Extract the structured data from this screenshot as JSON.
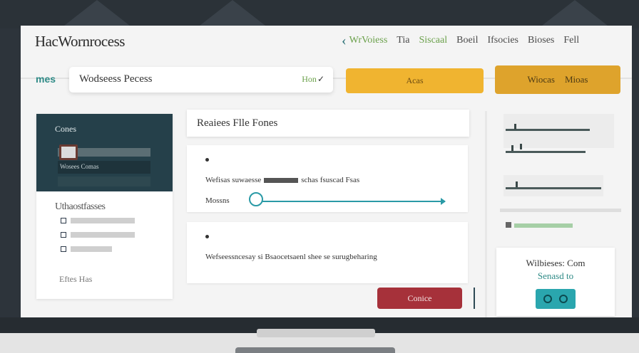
{
  "app": {
    "title": "HacWornrocess"
  },
  "nav": {
    "items": [
      "WrVoiess",
      "Tia",
      "Siscaal",
      "Boeil",
      "Ifsocies",
      "Bioses",
      "Fell"
    ]
  },
  "left_label": "mes",
  "search": {
    "value": "Wodseess Pecess",
    "filter": "Hon"
  },
  "buttons": {
    "yellow": "Acas",
    "orange_a": "Wiocas",
    "orange_b": "Mioas",
    "cancel": "Conice"
  },
  "left_panel": {
    "title": "Cones",
    "sub_label": "Wosees Comas",
    "heading": "Uthaostfasses",
    "footer": "Eftes Has"
  },
  "file_header": "Reaiees Flle Fones",
  "card1": {
    "line": "Wefisas suwaesse",
    "line_end": "schas fsuscad Fsas",
    "progress_label": "Mossns",
    "progress": 0.02
  },
  "card2": {
    "line": "Wefseessncesay si Bsaocetsaenl shee se surugbeharing"
  },
  "right_card": {
    "title": "Wilbieses: Com",
    "subtitle": "Senasd to"
  }
}
